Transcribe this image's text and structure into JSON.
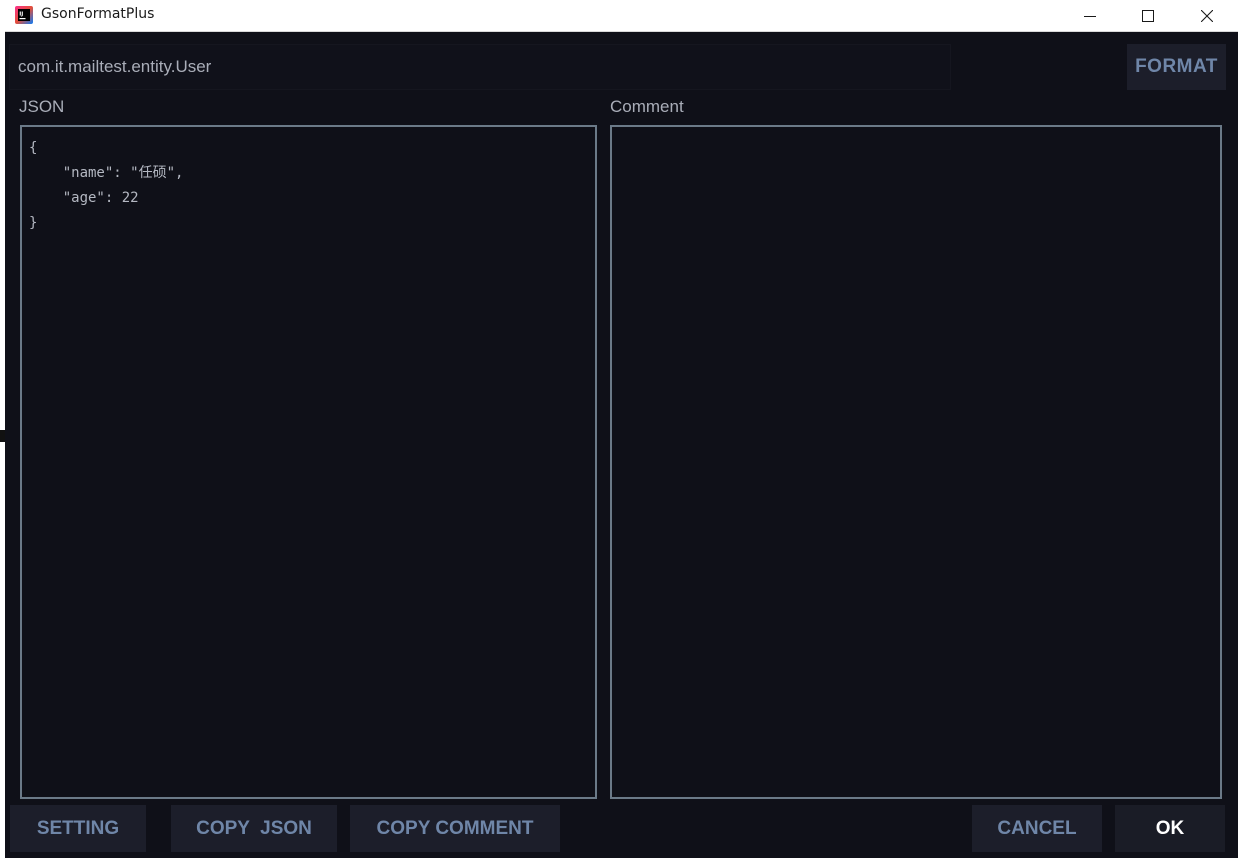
{
  "window": {
    "title": "GsonFormatPlus",
    "app_icon": "intellij-idea-icon",
    "controls": {
      "minimize_icon": "minimize-icon",
      "maximize_icon": "maximize-icon",
      "close_icon": "close-icon"
    }
  },
  "class_field": {
    "value": "com.it.mailtest.entity.User"
  },
  "toolbar": {
    "format_label": "FORMAT"
  },
  "json_section": {
    "label": "JSON",
    "content": "{\n    \"name\": \"任硕\",\n    \"age\": 22\n}"
  },
  "comment_section": {
    "label": "Comment",
    "content": ""
  },
  "buttons": {
    "setting": "SETTING",
    "copy_json": "COPY  JSON",
    "copy_comment": "COPY COMMENT",
    "cancel": "CANCEL",
    "ok": "OK"
  },
  "colors": {
    "background": "#0f1018",
    "panel_border": "#6b7a88",
    "button_bg": "#1c1e2a",
    "button_text": "#6f86a8",
    "ok_text": "#ffffff",
    "label_text": "#a9adb8"
  }
}
